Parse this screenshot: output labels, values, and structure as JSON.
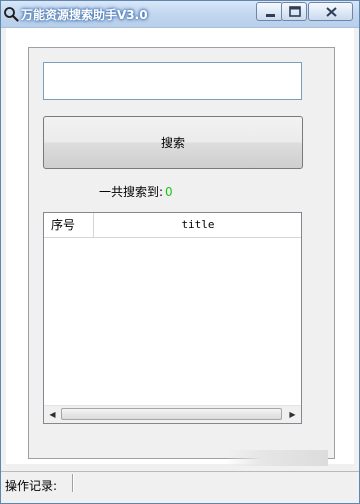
{
  "window": {
    "title": "万能资源搜索助手V3.0",
    "controls": {
      "minimize_icon": "minimize-icon",
      "maximize_icon": "maximize-icon",
      "close_icon": "close-icon"
    }
  },
  "search": {
    "input_value": "",
    "button_label": "搜索"
  },
  "result": {
    "count_label": "一共搜索到:",
    "count_value": "0"
  },
  "table": {
    "columns": [
      "序号",
      "title"
    ],
    "rows": []
  },
  "status": {
    "label": "操作记录:"
  },
  "colors": {
    "accent": "#4b79b6",
    "count": "#18c418"
  }
}
